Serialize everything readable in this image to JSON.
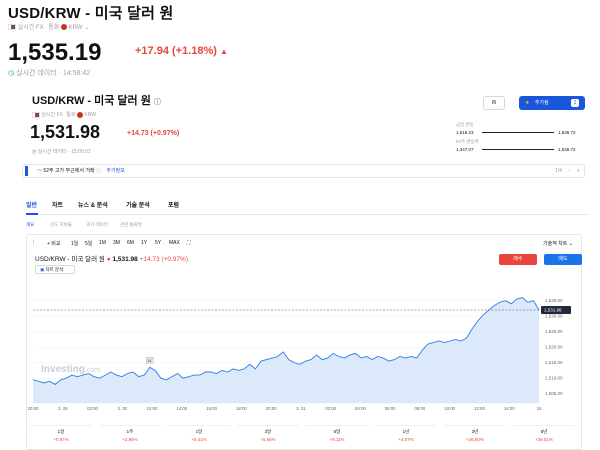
{
  "header": {
    "title": "USD/KRW - 미국 달러 원",
    "realtime_fx": "실시간 FX",
    "currency_label": "통화",
    "currency": "KRW",
    "price": "1,535.19",
    "change": "+17.94 (+1.18%)",
    "realtime_data": "실시간 데이터 · 14:58:42"
  },
  "card": {
    "title": "USD/KRW - 미국 달러 원",
    "realtime_fx": "실시간 FX",
    "currency_label": "통화",
    "currency": "KRW",
    "price": "1,531.98",
    "change": "+14.73 (+0.97%)",
    "realtime_data": "실시간 데이터 · 15:00:01",
    "watch_label": "추가됨",
    "watch_count": "1",
    "day_range": {
      "label": "금일 변동",
      "low": "1,516.23",
      "high": "1,536.72"
    },
    "week52_range": {
      "label": "52주 변동폭",
      "low": "1,347.07",
      "high": "1,536.72"
    },
    "alert_text": "52주 고가 부근에서 거래",
    "alert_link": "추가정보",
    "alert_pager": "1/4",
    "tabs": [
      "일반",
      "차트",
      "뉴스 & 분석",
      "기술 분석",
      "포럼"
    ],
    "subtabs": [
      "개요",
      "선도 지비율",
      "과거 데이터",
      "관련 통화쌍"
    ],
    "timeframes": [
      "1일",
      "5일",
      "1M",
      "3M",
      "6M",
      "1Y",
      "5Y",
      "MAX"
    ],
    "compare_label": "+ 비교",
    "tech_chart_label": "기술적 차트",
    "chart_title": "USD/KRW - 미국 달러 원",
    "chart_price": "1,531.98",
    "chart_change": "+14.73 (+0.97%)",
    "sell_label": "매수",
    "buy_label": "매도",
    "analysis_label": "차트 분석",
    "watermark": "Investing",
    "watermark_suffix": ".com",
    "marker_label": "14",
    "price_tag": "1,531.98",
    "performance": [
      {
        "period": "1일",
        "value": "+0.97%"
      },
      {
        "period": "1주",
        "value": "+2.86%"
      },
      {
        "period": "1달",
        "value": "+5.41%"
      },
      {
        "period": "3달",
        "value": "+5.56%"
      },
      {
        "period": "6달",
        "value": "+9.11%"
      },
      {
        "period": "1년",
        "value": "+4.07%"
      },
      {
        "period": "3년",
        "value": "+26.50%"
      },
      {
        "period": "5년",
        "value": "+26.51%"
      }
    ]
  },
  "chart_data": {
    "type": "area",
    "ylim": [
      1502,
      1542
    ],
    "yticks": [
      "1,535.00",
      "1,530.00",
      "1,525.00",
      "1,520.00",
      "1,515.00",
      "1,510.00",
      "1,505.00"
    ],
    "xticks": [
      "20:00",
      "3. 28",
      "02:00",
      "3. 30",
      "12:00",
      "14:00",
      "16:00",
      "18:00",
      "20:00",
      "3. 31",
      "02:00",
      "04:00",
      "06:00",
      "08:00",
      "10:00",
      "12:00",
      "14:00",
      "16"
    ],
    "reference_line": 1532.0,
    "values": [
      1509.5,
      1509.0,
      1508.5,
      1509.0,
      1508.0,
      1509.5,
      1510.0,
      1511.0,
      1510.5,
      1511.0,
      1511.5,
      1510.5,
      1510.0,
      1511.0,
      1512.0,
      1511.0,
      1510.5,
      1511.5,
      1512.0,
      1510.5,
      1511.0,
      1513.5,
      1512.5,
      1510.0,
      1509.5,
      1510.5,
      1511.5,
      1510.0,
      1510.5,
      1511.0,
      1511.0,
      1512.0,
      1512.0,
      1511.5,
      1512.5,
      1512.0,
      1513.0,
      1512.5,
      1513.0,
      1514.5,
      1513.0,
      1515.5,
      1516.0,
      1516.5,
      1517.0,
      1518.5,
      1516.0,
      1515.0,
      1514.5,
      1515.5,
      1516.0,
      1517.5,
      1516.0,
      1516.5,
      1518.0,
      1517.0,
      1516.5,
      1517.5,
      1518.0,
      1516.5,
      1517.0,
      1516.0,
      1517.0,
      1516.5,
      1515.5,
      1516.0,
      1517.0,
      1516.5,
      1517.0,
      1516.5,
      1519.0,
      1521.0,
      1521.5,
      1522.0,
      1521.5,
      1522.0,
      1522.5,
      1522.0,
      1523.0,
      1526.0,
      1528.5,
      1530.5,
      1532.0,
      1533.5,
      1534.5,
      1535.0,
      1534.0,
      1535.5,
      1536.0,
      1534.5,
      1535.0,
      1532.0
    ]
  }
}
